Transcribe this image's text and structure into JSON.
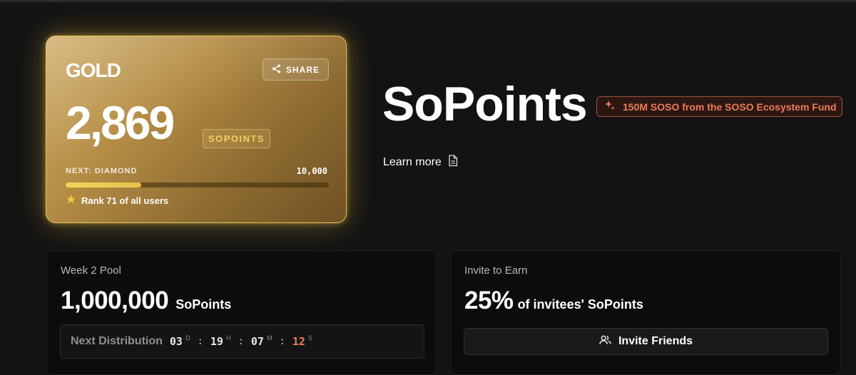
{
  "gold_card": {
    "tier": "GOLD",
    "share_label": "SHARE",
    "points": "2,869",
    "points_unit": "SOPOINTS",
    "next_tier_label": "NEXT: DIAMOND",
    "next_tier_threshold": "10,000",
    "progress_fraction": 0.287,
    "rank_text": "Rank 71 of all users"
  },
  "header": {
    "title": "SoPoints",
    "fund_badge": "150M SOSO from the SOSO Ecosystem Fund",
    "learn_more": "Learn more"
  },
  "pool_card": {
    "label": "Week 2 Pool",
    "amount": "1,000,000",
    "unit": "SoPoints",
    "countdown_label": "Next Distribution",
    "days": "03",
    "days_unit": "D",
    "hours": "19",
    "hours_unit": "H",
    "minutes": "07",
    "minutes_unit": "M",
    "seconds": "12",
    "seconds_unit": "S",
    "separator": ":"
  },
  "invite_card": {
    "label": "Invite to Earn",
    "percent": "25%",
    "text": "of invitees' SoPoints",
    "button_label": "Invite Friends"
  },
  "colors": {
    "accent_orange": "#f07b5a",
    "gold_accent": "#f3cf62",
    "background": "#131313"
  },
  "icons": {
    "share": "share-icon",
    "star": "star-icon",
    "sparkle": "sparkle-icon",
    "document": "document-icon",
    "users": "users-icon"
  }
}
